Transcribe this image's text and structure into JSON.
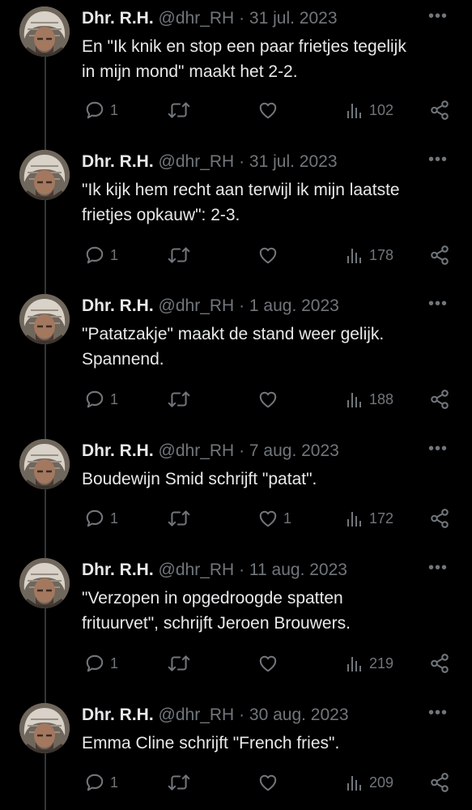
{
  "tweets": [
    {
      "name": "Dhr. R.H.",
      "handle": "@dhr_RH",
      "separator": "·",
      "date": "31 jul. 2023",
      "lines": [
        "En \"Ik knik en stop een paar frietjes tegelijk",
        "in mijn mond\" maakt het 2-2."
      ],
      "reply_count": "1",
      "retweet_count": "",
      "like_count": "",
      "view_count": "102"
    },
    {
      "name": "Dhr. R.H.",
      "handle": "@dhr_RH",
      "separator": "·",
      "date": "31 jul. 2023",
      "lines": [
        "\"Ik kijk hem recht aan terwijl ik mijn laatste",
        "frietjes opkauw\": 2-3."
      ],
      "reply_count": "1",
      "retweet_count": "",
      "like_count": "",
      "view_count": "178"
    },
    {
      "name": "Dhr. R.H.",
      "handle": "@dhr_RH",
      "separator": "·",
      "date": "1 aug. 2023",
      "lines": [
        "\"Patatzakje\" maakt de stand weer gelijk.",
        "Spannend."
      ],
      "reply_count": "1",
      "retweet_count": "",
      "like_count": "",
      "view_count": "188"
    },
    {
      "name": "Dhr. R.H.",
      "handle": "@dhr_RH",
      "separator": "·",
      "date": "7 aug. 2023",
      "lines": [
        "Boudewijn Smid schrijft \"patat\"."
      ],
      "reply_count": "1",
      "retweet_count": "",
      "like_count": "1",
      "view_count": "172"
    },
    {
      "name": "Dhr. R.H.",
      "handle": "@dhr_RH",
      "separator": "·",
      "date": "11 aug. 2023",
      "lines": [
        "\"Verzopen in opgedroogde spatten",
        "frituurvet\", schrijft Jeroen Brouwers."
      ],
      "reply_count": "1",
      "retweet_count": "",
      "like_count": "",
      "view_count": "219"
    },
    {
      "name": "Dhr. R.H.",
      "handle": "@dhr_RH",
      "separator": "·",
      "date": "30 aug. 2023",
      "lines": [
        "Emma Cline schrijft \"French fries\"."
      ],
      "reply_count": "1",
      "retweet_count": "",
      "like_count": "",
      "view_count": "209"
    }
  ],
  "icons": {
    "more": "more-dots-icon",
    "reply": "reply-bubble-icon",
    "retweet": "retweet-arrows-icon",
    "like": "heart-icon",
    "views": "views-bars-icon",
    "share": "share-nodes-icon"
  },
  "colors": {
    "background": "#000000",
    "text": "#e7e9ea",
    "muted": "#71767b",
    "thread_line": "#333639"
  }
}
